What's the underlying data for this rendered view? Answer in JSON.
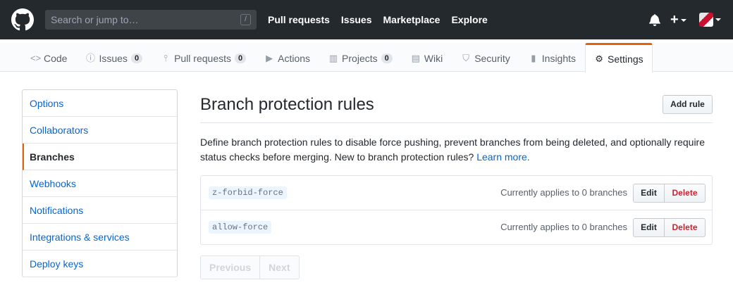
{
  "header": {
    "search_placeholder": "Search or jump to…",
    "search_key": "/",
    "nav": [
      "Pull requests",
      "Issues",
      "Marketplace",
      "Explore"
    ],
    "plus": "+"
  },
  "repo_nav": {
    "tabs": [
      {
        "label": "Code",
        "icon": "code-icon",
        "counter": null
      },
      {
        "label": "Issues",
        "icon": "issue-icon",
        "counter": "0"
      },
      {
        "label": "Pull requests",
        "icon": "pull-request-icon",
        "counter": "0"
      },
      {
        "label": "Actions",
        "icon": "play-icon",
        "counter": null
      },
      {
        "label": "Projects",
        "icon": "project-icon",
        "counter": "0"
      },
      {
        "label": "Wiki",
        "icon": "book-icon",
        "counter": null
      },
      {
        "label": "Security",
        "icon": "shield-icon",
        "counter": null
      },
      {
        "label": "Insights",
        "icon": "graph-icon",
        "counter": null
      },
      {
        "label": "Settings",
        "icon": "gear-icon",
        "counter": null
      }
    ],
    "selected": "Settings"
  },
  "sidebar": {
    "items": [
      "Options",
      "Collaborators",
      "Branches",
      "Webhooks",
      "Notifications",
      "Integrations & services",
      "Deploy keys"
    ],
    "selected": "Branches"
  },
  "main": {
    "title": "Branch protection rules",
    "add_rule": "Add rule",
    "description": "Define branch protection rules to disable force pushing, prevent branches from being deleted, and optionally require status checks before merging. New to branch protection rules?",
    "learn_more": "Learn more.",
    "rules": [
      {
        "name": "z-forbid-force",
        "applies": "Currently applies to 0 branches",
        "edit": "Edit",
        "delete": "Delete"
      },
      {
        "name": "allow-force",
        "applies": "Currently applies to 0 branches",
        "edit": "Edit",
        "delete": "Delete"
      }
    ],
    "pagination": {
      "previous": "Previous",
      "next": "Next"
    }
  },
  "colors": {
    "header_bg": "#24292e",
    "link": "#0366d6",
    "accent": "#e36209",
    "danger": "#cb2431"
  }
}
